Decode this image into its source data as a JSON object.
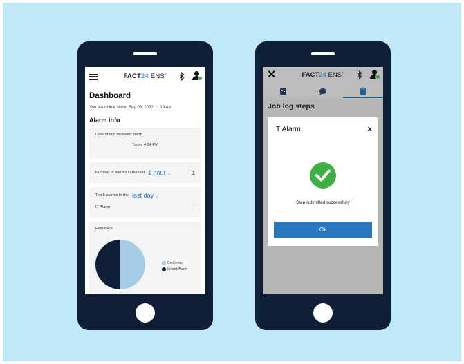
{
  "colors": {
    "background": "#bfe9f7",
    "phone": "#0e1f37",
    "accent_blue": "#2d7bc6",
    "success_green": "#3fae45",
    "pie_confirmed": "#a7cde6",
    "pie_invalid": "#0e1f37"
  },
  "left_phone": {
    "brand": {
      "prefix": "FACT",
      "number": "24",
      "suffix": " ENS",
      "plus": "+"
    },
    "icons": [
      "menu-icon",
      "bluetooth-icon",
      "user-icon"
    ],
    "title": "Dashboard",
    "online_since": "You are online since: Sep 06, 2022 11:19 AM",
    "section_title": "Alarm info",
    "last_alarm": {
      "label": "Date of last received alarm",
      "value": "Today 4:04 PM"
    },
    "alarms_count": {
      "label": "Number of alarms in the last",
      "period": "1 hour",
      "value": "1"
    },
    "top_alarms": {
      "label": "Top 5 alarms in the",
      "period": "last day",
      "item_name": "IT Alarm",
      "item_count": "1"
    },
    "feedback": {
      "title": "Feedback",
      "legend": [
        {
          "label": "Confirmed",
          "color": "#a7cde6"
        },
        {
          "label": "Invalid Alarm",
          "color": "#0e1f37"
        }
      ],
      "pie_split": {
        "confirmed": 0.5,
        "invalid": 0.5
      }
    }
  },
  "right_phone": {
    "brand": {
      "prefix": "FACT",
      "number": "24",
      "suffix": " ENS",
      "plus": "+"
    },
    "icons": [
      "close-icon",
      "bluetooth-icon",
      "user-icon"
    ],
    "tabs": [
      "tab-contacts",
      "tab-chat",
      "tab-clipboard"
    ],
    "active_tab": 2,
    "page_title": "Job log steps",
    "dialog": {
      "title": "IT Alarm",
      "close_label": "×",
      "message": "Step submitted successfully",
      "ok_label": "Ok"
    }
  }
}
